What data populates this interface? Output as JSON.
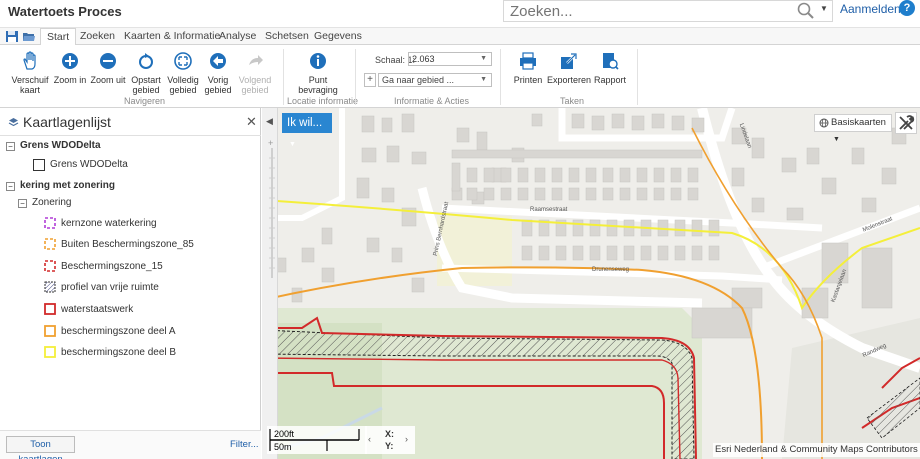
{
  "app": {
    "title": "Watertoets Proces"
  },
  "search": {
    "placeholder": "Zoeken..."
  },
  "header": {
    "login_label": "Aanmelden",
    "help_glyph": "?"
  },
  "tabs": [
    {
      "label": "Start",
      "active": true
    },
    {
      "label": "Zoeken"
    },
    {
      "label": "Kaarten & Informatie"
    },
    {
      "label": "Analyse"
    },
    {
      "label": "Schetsen"
    },
    {
      "label": "Gegevens"
    }
  ],
  "ribbon": {
    "navigate": {
      "label": "Navigeren",
      "buttons": [
        {
          "line1": "Verschuif",
          "line2": "kaart",
          "icon": "hand-icon"
        },
        {
          "line1": "Zoom in",
          "line2": "",
          "icon": "zoom-in-icon"
        },
        {
          "line1": "Zoom uit",
          "line2": "",
          "icon": "zoom-out-icon"
        },
        {
          "line1": "Opstart",
          "line2": "gebied",
          "icon": "refresh-icon"
        },
        {
          "line1": "Volledig",
          "line2": "gebied",
          "icon": "full-extent-icon"
        },
        {
          "line1": "Vorig",
          "line2": "gebied",
          "icon": "back-icon"
        },
        {
          "line1": "Volgend",
          "line2": "gebied",
          "icon": "forward-icon",
          "disabled": true
        }
      ]
    },
    "location": {
      "label": "Locatie informatie",
      "button": {
        "line1": "Punt",
        "line2": "bevraging",
        "icon": "info-icon"
      }
    },
    "info": {
      "label": "Informatie & Acties",
      "scale_label": "Schaal: 1:",
      "scale_value": "2.063",
      "goto_placeholder": "Ga naar gebied ..."
    },
    "tasks": {
      "label": "Taken",
      "buttons": [
        {
          "label": "Printen",
          "icon": "printer-icon"
        },
        {
          "label": "Exporteren",
          "icon": "export-icon"
        },
        {
          "label": "Rapport",
          "icon": "report-icon"
        }
      ]
    }
  },
  "sidebar": {
    "title": "Kaartlagenlijst",
    "groups": [
      {
        "label": "Grens WDODelta",
        "items": [
          {
            "label": "Grens WDODelta",
            "color": "#333333",
            "style": "solid"
          }
        ]
      },
      {
        "label": "kering met zonering",
        "subgroup": "Zonering",
        "items": [
          {
            "label": "kernzone waterkering",
            "color": "#b03dd6",
            "style": "dashed"
          },
          {
            "label": "Buiten Beschermingszone_85",
            "color": "#f0a030",
            "style": "dashed"
          },
          {
            "label": "Beschermingszone_15",
            "color": "#d22a2a",
            "style": "dashed"
          },
          {
            "label": "profiel  van vrije ruimte",
            "color": "#4a4f88",
            "style": "hatched"
          },
          {
            "label": "waterstaatswerk",
            "color": "#d22a2a",
            "style": "solid"
          },
          {
            "label": "beschermingszone deel A",
            "color": "#f0a030",
            "style": "solid"
          },
          {
            "label": "beschermingszone deel B",
            "color": "#f4ef3a",
            "style": "solid"
          }
        ]
      }
    ],
    "show_layers_label": "Toon kaartlagen",
    "filter_label": "Filter..."
  },
  "map": {
    "ik_wil_label": "Ik wil...",
    "basemap_label": "Basiskaarten",
    "scale_ft": "200ft",
    "scale_m": "50m",
    "coord_x": "X:",
    "coord_y": "Y:",
    "attribution": "Esri Nederland & Community Maps Contributors",
    "street_labels": [
      "Raamsestraat",
      "Prins Bernhardstraat",
      "Drunenseweg",
      "Molenstraat",
      "Kastanjelaan",
      "Randweg",
      "Lindelaan"
    ]
  }
}
